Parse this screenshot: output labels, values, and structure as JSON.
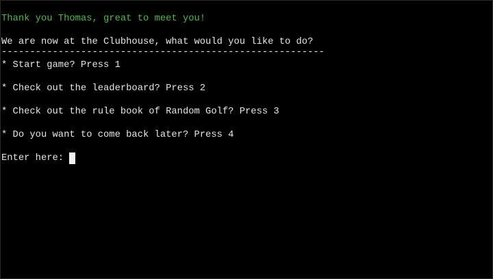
{
  "greeting": "Thank you Thomas, great to meet you!",
  "prompt_heading": "We are now at the Clubhouse, what would you like to do?",
  "divider": "---------------------------------------------------------",
  "menu": [
    {
      "label": "* Start game? Press 1"
    },
    {
      "label": "* Check out the leaderboard? Press 2"
    },
    {
      "label": "* Check out the rule book of Random Golf? Press 3"
    },
    {
      "label": "* Do you want to come back later? Press 4"
    }
  ],
  "input_prompt": "Enter here:",
  "colors": {
    "background": "#000000",
    "text": "#e6e6e6",
    "greeting": "#4fb848",
    "cursor": "#f2f2f2"
  }
}
